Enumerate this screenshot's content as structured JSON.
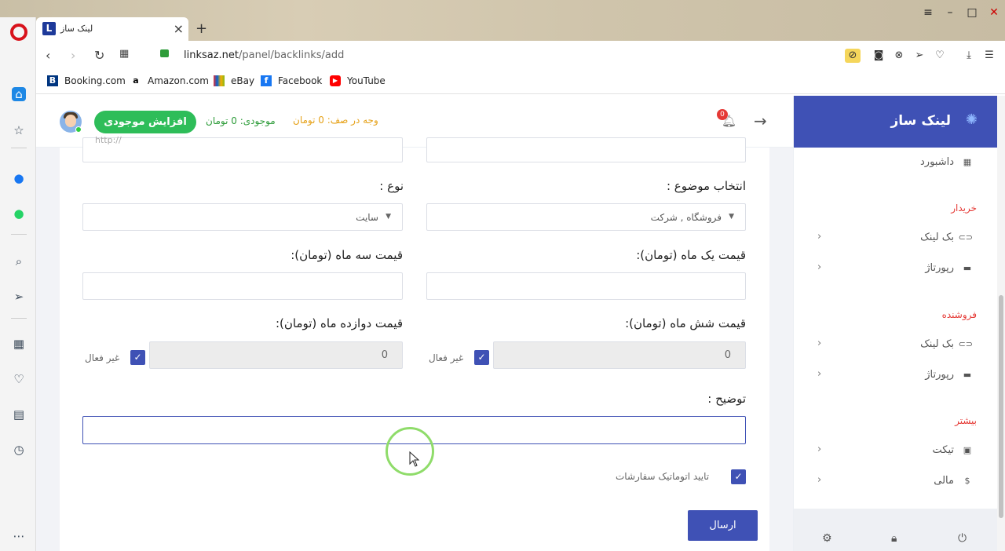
{
  "browser": {
    "tab_title": "لینک ساز",
    "tab_logo_letter": "L",
    "url_host": "linksaz.net",
    "url_path": "/panel/backlinks/add",
    "bookmarks": [
      {
        "label": "Booking.com",
        "icon": "booking-icon",
        "color": "#003580"
      },
      {
        "label": "Amazon.com",
        "icon": "amazon-icon",
        "color": "#000000"
      },
      {
        "label": "eBay",
        "icon": "ebay-icon",
        "color": "#e53238"
      },
      {
        "label": "Facebook",
        "icon": "facebook-icon",
        "color": "#1877f2"
      },
      {
        "label": "YouTube",
        "icon": "youtube-icon",
        "color": "#ff0000"
      }
    ]
  },
  "header": {
    "add_balance_button": "افزایش موجودی",
    "balance_text": "موجودی: 0 تومان",
    "pending_text": "وجه در صف: 0 تومان",
    "notification_count": "0"
  },
  "form": {
    "url_placeholder": "http://",
    "type_label": "نوع :",
    "type_value": "سایت",
    "topic_label": "انتخاب موضوع :",
    "topic_value": "فروشگاه , شرکت",
    "price_3m_label": "قیمت سه ماه (تومان):",
    "price_1m_label": "قیمت یک ماه (تومان):",
    "price_12m_label": "قیمت دوازده ماه (تومان):",
    "price_6m_label": "قیمت شش ماه (تومان):",
    "price_12m_value": "0",
    "price_6m_value": "0",
    "inactive_label": "غیر فعال",
    "description_label": "توضیح :",
    "auto_confirm_label": "تایید اتوماتیک سفارشات",
    "submit_label": "ارسال"
  },
  "sidebar": {
    "brand": "لینک ساز",
    "dashboard": "داشبورد",
    "buyer_section": "خریدار",
    "seller_section": "فروشنده",
    "more_section": "بیشتر",
    "buyer_items": [
      "بک لینک",
      "رپورتاژ"
    ],
    "seller_items": [
      "بک لینک",
      "رپورتاژ"
    ],
    "more_items": [
      "تیکت",
      "مالی"
    ]
  },
  "colors": {
    "primary": "#3f51b5",
    "success": "#2ebd59",
    "warning": "#e6a21a",
    "danger": "#e53935"
  }
}
